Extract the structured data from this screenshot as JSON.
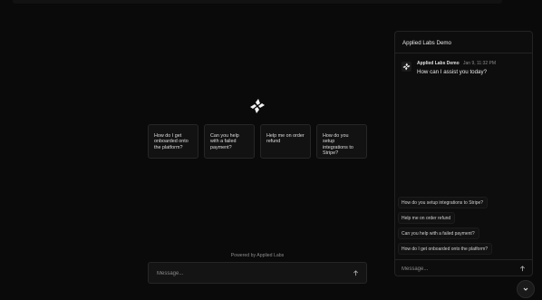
{
  "main": {
    "suggestions": [
      {
        "label": "How do I get onboarded onto the platform?"
      },
      {
        "label": "Can you help with a failed payment?"
      },
      {
        "label": "Help me on order refund"
      },
      {
        "label": "How do you setup integrations to Stripe?"
      }
    ],
    "powered_by": "Powered by Applied Labs",
    "input_placeholder": "Message..."
  },
  "chat_panel": {
    "title": "Applied Labs Demo",
    "message": {
      "sender": "Applied Labs Demo",
      "timestamp": "Jan 9, 11:32 PM",
      "text": "How can I assist you today?"
    },
    "suggestions": [
      {
        "label": "How do you setup integrations to Stripe?"
      },
      {
        "label": "Help me on order refund"
      },
      {
        "label": "Can you help with a failed payment?"
      },
      {
        "label": "How do I get onboarded onto the platform?"
      }
    ],
    "input_placeholder": "Message..."
  },
  "icons": {
    "logo": "sparkle-logo-icon",
    "send": "arrow-up-icon",
    "scroll_down": "chevron-down-icon"
  }
}
